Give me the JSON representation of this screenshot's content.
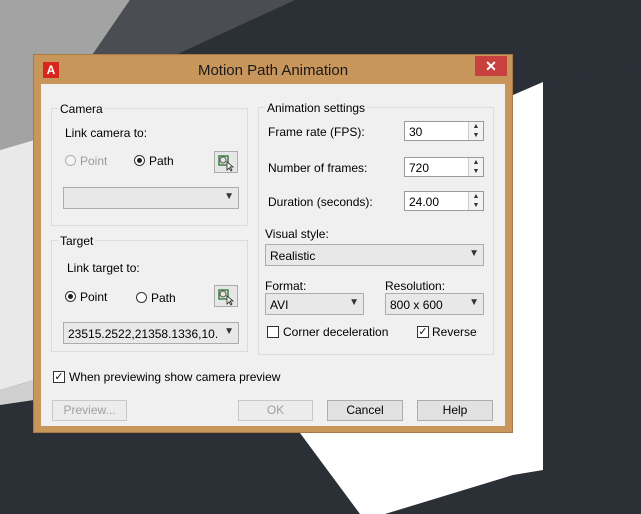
{
  "dialog": {
    "title": "Motion Path Animation",
    "app_icon": "autocad-icon",
    "close_symbol": "✕"
  },
  "camera": {
    "group_label": "Camera",
    "link_label": "Link camera to:",
    "point_label": "Point",
    "path_label": "Path",
    "selected": "Path",
    "path_value": ""
  },
  "target": {
    "group_label": "Target",
    "link_label": "Link target to:",
    "point_label": "Point",
    "path_label": "Path",
    "selected": "Point",
    "point_value": "23515.2522,21358.1336,10..."
  },
  "animation": {
    "group_label": "Animation settings",
    "frame_rate_label": "Frame rate (FPS):",
    "frame_rate_value": "30",
    "frames_label": "Number of frames:",
    "frames_value": "720",
    "duration_label": "Duration (seconds):",
    "duration_value": "24.00",
    "visual_style_label": "Visual style:",
    "visual_style_value": "Realistic",
    "format_label": "Format:",
    "format_value": "AVI",
    "resolution_label": "Resolution:",
    "resolution_value": "800 x 600",
    "corner_decel_label": "Corner deceleration",
    "corner_decel_checked": false,
    "reverse_label": "Reverse",
    "reverse_checked": true
  },
  "preview_option": {
    "label": "When previewing show camera preview",
    "checked": true
  },
  "buttons": {
    "preview": "Preview...",
    "ok": "OK",
    "cancel": "Cancel",
    "help": "Help"
  },
  "colors": {
    "frame": "#c8955b",
    "close": "#c7423f",
    "dialog_bg": "#f0f0f0"
  }
}
